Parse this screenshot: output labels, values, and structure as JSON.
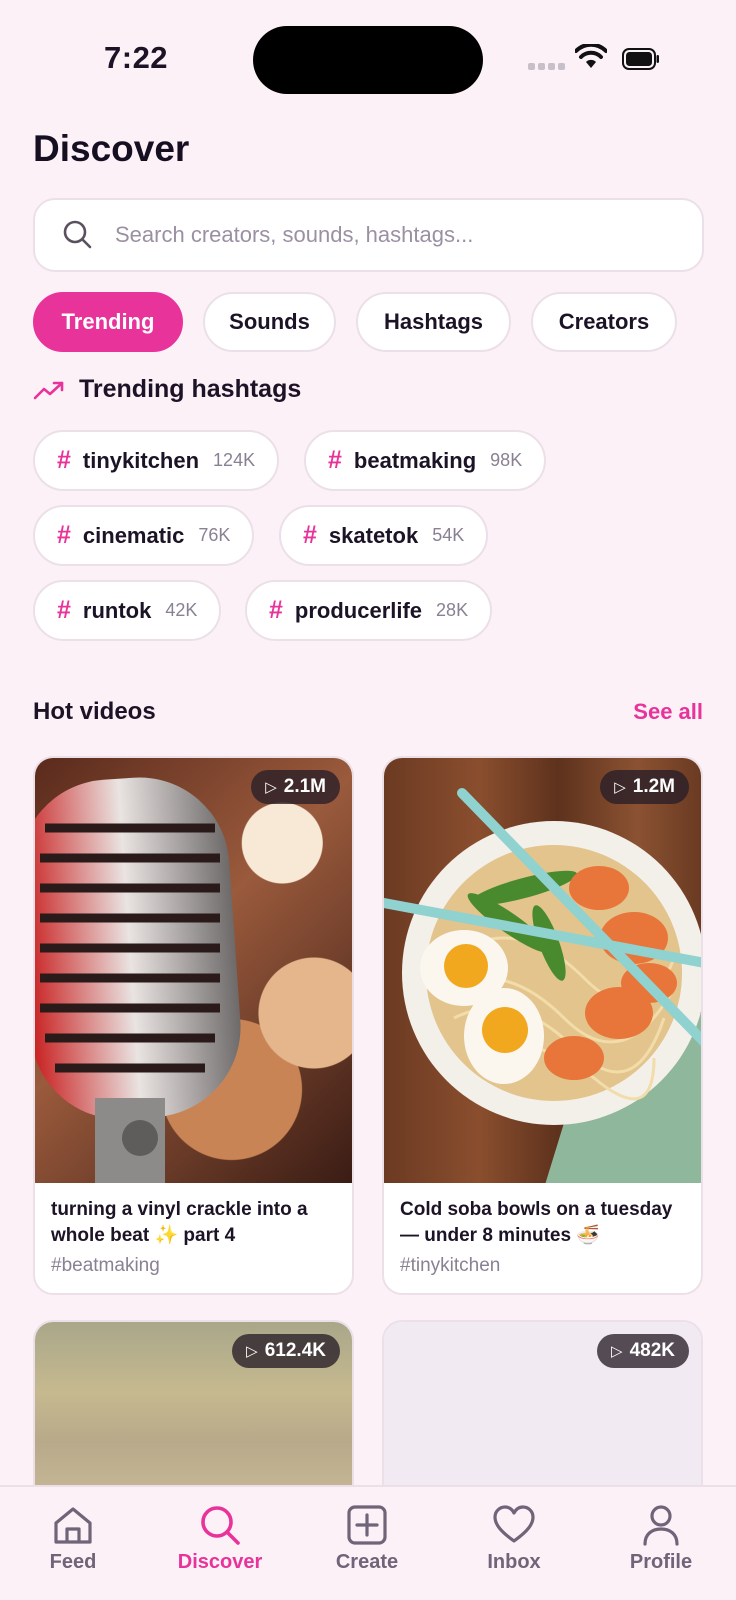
{
  "status_bar": {
    "time": "7:22"
  },
  "page": {
    "title": "Discover"
  },
  "search": {
    "placeholder": "Search creators, sounds, hashtags..."
  },
  "tabs": [
    {
      "label": "Trending",
      "active": true
    },
    {
      "label": "Sounds",
      "active": false
    },
    {
      "label": "Hashtags",
      "active": false
    },
    {
      "label": "Creators",
      "active": false
    }
  ],
  "trending": {
    "title": "Trending hashtags",
    "hashtags": [
      {
        "tag": "tinykitchen",
        "count": "124K"
      },
      {
        "tag": "beatmaking",
        "count": "98K"
      },
      {
        "tag": "cinematic",
        "count": "76K"
      },
      {
        "tag": "skatetok",
        "count": "54K"
      },
      {
        "tag": "runtok",
        "count": "42K"
      },
      {
        "tag": "producerlife",
        "count": "28K"
      }
    ]
  },
  "hot_videos": {
    "title": "Hot videos",
    "see_all": "See all",
    "videos": [
      {
        "views": "2.1M",
        "title": "turning a vinyl crackle into a whole beat ✨ part 4",
        "hashtag": "#beatmaking"
      },
      {
        "views": "1.2M",
        "title": "Cold soba bowls on a tuesday — under 8 minutes 🍜",
        "hashtag": "#tinykitchen"
      },
      {
        "views": "612.4K"
      },
      {
        "views": "482K"
      }
    ]
  },
  "bottom_nav": [
    {
      "label": "Feed",
      "icon": "home-icon",
      "active": false
    },
    {
      "label": "Discover",
      "icon": "search-icon",
      "active": true
    },
    {
      "label": "Create",
      "icon": "plus-square-icon",
      "active": false
    },
    {
      "label": "Inbox",
      "icon": "heart-icon",
      "active": false
    },
    {
      "label": "Profile",
      "icon": "user-icon",
      "active": false
    }
  ],
  "colors": {
    "accent": "#e8339a",
    "background": "#fdf1f8",
    "text": "#1c1326",
    "muted": "#8a8093"
  }
}
